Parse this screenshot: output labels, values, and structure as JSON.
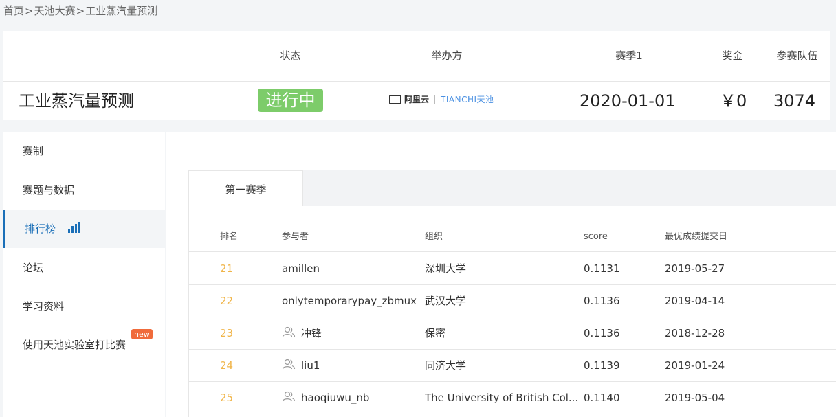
{
  "breadcrumb": [
    "首页",
    "天池大赛",
    "工业蒸汽量预测"
  ],
  "breadcrumb_sep": ">",
  "header": {
    "labels": {
      "status": "状态",
      "organizer": "举办方",
      "season": "赛季1",
      "prize": "奖金",
      "teams": "参赛队伍"
    },
    "title": "工业蒸汽量预测",
    "status": "进行中",
    "organizer_logo": {
      "aliyun": "阿里云",
      "tianchi_en": "TIANCHI",
      "tianchi_cn": "天池"
    },
    "season_date": "2020-01-01",
    "prize": "￥0",
    "teams": "3074",
    "status_color": "#7dcc6a"
  },
  "sidebar": {
    "items": [
      {
        "label": "赛制"
      },
      {
        "label": "赛题与数据"
      },
      {
        "label": "排行榜",
        "icon": "bar-chart-icon",
        "active": true
      },
      {
        "label": "论坛"
      },
      {
        "label": "学习资料"
      },
      {
        "label": "使用天池实验室打比赛",
        "badge": "new"
      }
    ],
    "accent_color": "#1a6fb8"
  },
  "leaderboard": {
    "tabs": [
      "第一赛季"
    ],
    "columns": [
      "排名",
      "参与者",
      "组织",
      "score",
      "最优成绩提交日"
    ],
    "rows": [
      {
        "rank": "21",
        "user": "amillen",
        "user_icon": false,
        "org": "深圳大学",
        "score": "0.1131",
        "date": "2019-05-27"
      },
      {
        "rank": "22",
        "user": "onlytemporarypay_zbmux",
        "user_icon": false,
        "org": "武汉大学",
        "score": "0.1136",
        "date": "2019-04-14"
      },
      {
        "rank": "23",
        "user": "冲锋",
        "user_icon": true,
        "org": "保密",
        "score": "0.1136",
        "date": "2018-12-28"
      },
      {
        "rank": "24",
        "user": "liu1",
        "user_icon": true,
        "org": "同济大学",
        "score": "0.1139",
        "date": "2019-01-24"
      },
      {
        "rank": "25",
        "user": "haoqiuwu_nb",
        "user_icon": true,
        "org": "The University of British Col...",
        "score": "0.1140",
        "date": "2019-05-04"
      }
    ],
    "rank_color": "#f0b54a"
  }
}
